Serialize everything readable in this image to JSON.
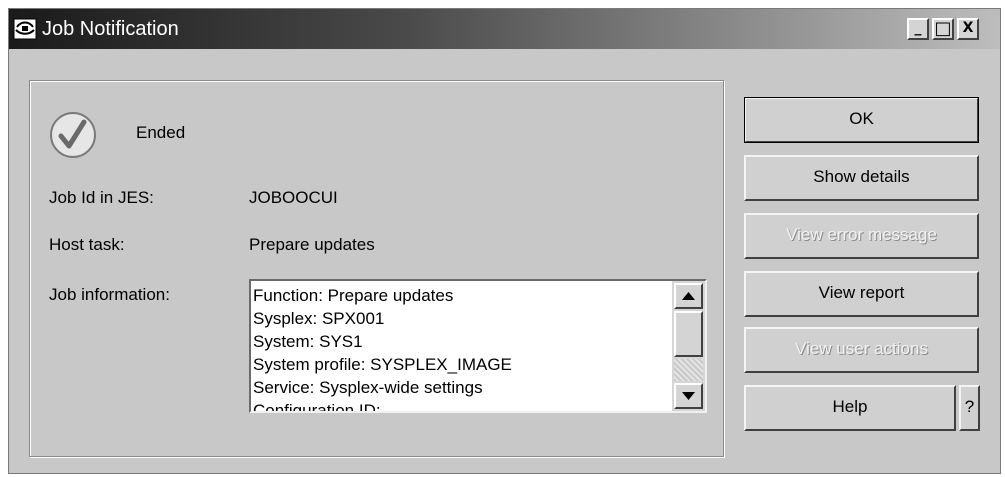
{
  "window": {
    "title": "Job Notification",
    "controls": {
      "minimize": "_",
      "maximize": "□",
      "close": "X"
    }
  },
  "status": {
    "icon": "checkmark-circle-icon",
    "text": "Ended"
  },
  "fields": [
    {
      "label": "Job Id in JES:",
      "value": "JOBOOCUI"
    },
    {
      "label": "Host task:",
      "value": "Prepare updates"
    }
  ],
  "job_info": {
    "label": "Job information:",
    "lines": [
      "Function: Prepare updates",
      "Sysplex: SPX001",
      "System: SYS1",
      "System profile: SYSPLEX_IMAGE",
      "Service: Sysplex-wide settings",
      "Configuration ID:"
    ]
  },
  "buttons": {
    "ok": "OK",
    "show_details": "Show details",
    "view_error_message": "View error message",
    "view_report": "View report",
    "view_user_actions": "View user actions",
    "help": "Help",
    "help_q": "?"
  }
}
